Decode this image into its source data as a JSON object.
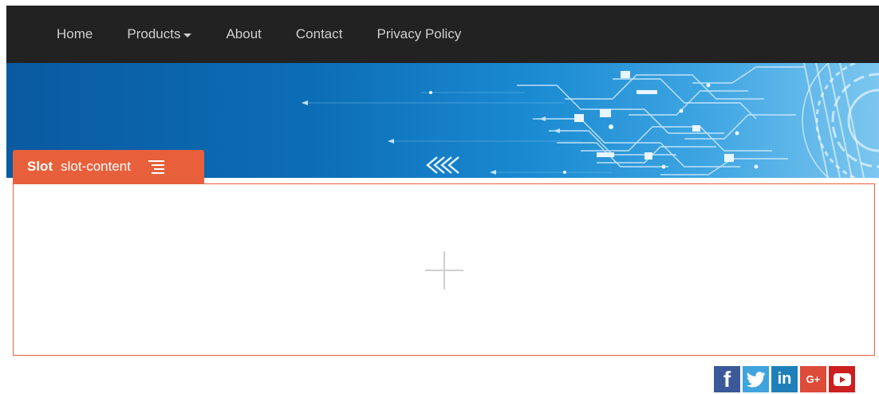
{
  "nav": {
    "items": [
      {
        "label": "Home"
      },
      {
        "label": "Products",
        "has_dropdown": true
      },
      {
        "label": "About"
      },
      {
        "label": "Contact"
      },
      {
        "label": "Privacy Policy"
      }
    ]
  },
  "slot": {
    "label": "Slot",
    "name": "slot-content",
    "menu_icon": "hamburger-menu-icon",
    "add_icon": "plus-icon"
  },
  "social": {
    "icons": [
      "facebook-icon",
      "twitter-icon",
      "linkedin-icon",
      "google-plus-icon",
      "youtube-icon"
    ],
    "facebook_glyph": "f",
    "linkedin_glyph": "in",
    "googleplus_glyph": "G+"
  },
  "colors": {
    "navbar_bg": "#222222",
    "slot_accent": "#e8603b",
    "banner_blue": "#0c6db6"
  }
}
